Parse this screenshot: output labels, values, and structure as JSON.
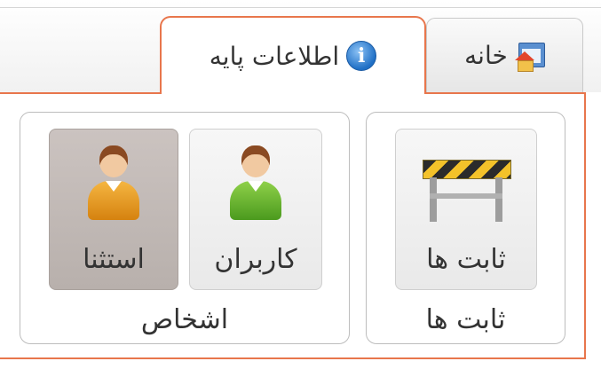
{
  "tabs": {
    "home_label": "خانه",
    "base_info_label": "اطلاعات پایه",
    "info_glyph": "i"
  },
  "groups": {
    "constants": {
      "label": "ثابت ها",
      "buttons": [
        {
          "label": "ثابت ها",
          "icon": "barrier-icon"
        }
      ]
    },
    "people": {
      "label": "اشخاص",
      "buttons": [
        {
          "label": "کاربران",
          "icon": "user-green-icon"
        },
        {
          "label": "استثنا",
          "icon": "user-orange-icon",
          "selected": true
        }
      ]
    }
  },
  "colors": {
    "accent_border": "#e8764c",
    "selected_button": "#bfb7b3"
  }
}
